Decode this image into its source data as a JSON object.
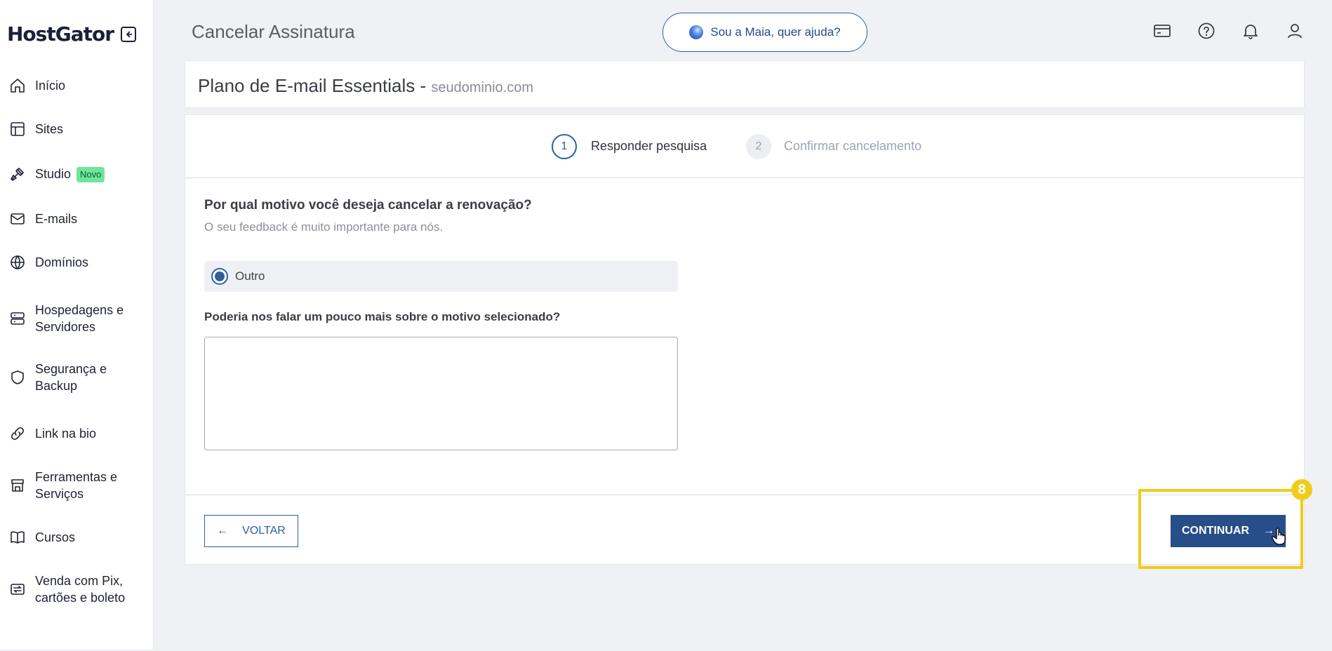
{
  "sidebar": {
    "logo": "HostGator",
    "items": [
      {
        "label": "Início",
        "icon": "home-icon"
      },
      {
        "label": "Sites",
        "icon": "layout-icon"
      },
      {
        "label": "Studio",
        "icon": "tools-icon",
        "badge": "Novo"
      },
      {
        "label": "E-mails",
        "icon": "mail-icon"
      },
      {
        "label": "Domínios",
        "icon": "globe-icon"
      },
      {
        "label": "Hospedagens e Servidores",
        "icon": "server-icon"
      },
      {
        "label": "Segurança e Backup",
        "icon": "shield-icon"
      },
      {
        "label": "Link na bio",
        "icon": "link-icon"
      },
      {
        "label": "Ferramentas e Serviços",
        "icon": "store-icon"
      },
      {
        "label": "Cursos",
        "icon": "book-icon"
      },
      {
        "label": "Venda com Pix, cartões e boleto",
        "icon": "transfer-icon"
      }
    ]
  },
  "header": {
    "title": "Cancelar Assinatura",
    "assistant_label": "Sou a Maia, quer ajuda?",
    "icons": [
      "card-icon",
      "help-icon",
      "bell-icon",
      "user-icon"
    ]
  },
  "plan": {
    "name": "Plano de E-mail Essentials -",
    "domain": "seudominio.com"
  },
  "steps": [
    {
      "number": "1",
      "label": "Responder pesquisa",
      "active": true
    },
    {
      "number": "2",
      "label": "Confirmar cancelamento",
      "active": false
    }
  ],
  "form": {
    "question": "Por qual motivo você deseja cancelar a renovação?",
    "subtitle": "O seu feedback é muito importante para nós.",
    "selected_option": "Outro",
    "detail_question": "Poderia nos falar um pouco mais sobre o motivo selecionado?",
    "detail_value": ""
  },
  "actions": {
    "back_label": "VOLTAR",
    "next_label": "CONTINUAR"
  },
  "annotation": {
    "step_badge": "8",
    "highlight_color": "#f1cc1a"
  },
  "colors": {
    "primary": "#284e8a",
    "accent_blue": "#2e5fa0",
    "badge_green": "#6ee59a"
  }
}
